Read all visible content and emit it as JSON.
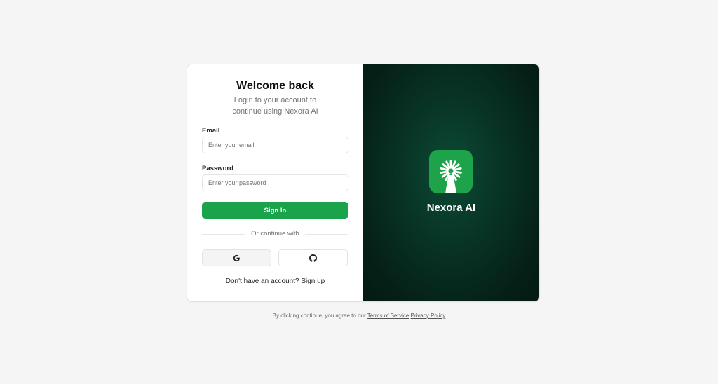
{
  "login": {
    "title": "Welcome back",
    "subtitle": "Login to your account to continue using Nexora AI",
    "email_label": "Email",
    "email_placeholder": "Enter your email",
    "email_value": "",
    "password_label": "Password",
    "password_placeholder": "Enter your password",
    "password_value": "",
    "signin_label": "Sign In",
    "divider_text": "Or continue with",
    "google_icon": "google-icon",
    "github_icon": "github-icon",
    "signup_prompt": "Don't have an account?",
    "signup_link": "Sign up"
  },
  "brand": {
    "name": "Nexora AI",
    "logo_icon": "sunburst-logo-icon"
  },
  "footer": {
    "text": "By clicking continue, you agree to our",
    "terms": "Terms of Service",
    "privacy": "Privacy Policy"
  },
  "colors": {
    "accent": "#1aa34a",
    "panel": "#083425",
    "background": "#f5f5f5"
  }
}
